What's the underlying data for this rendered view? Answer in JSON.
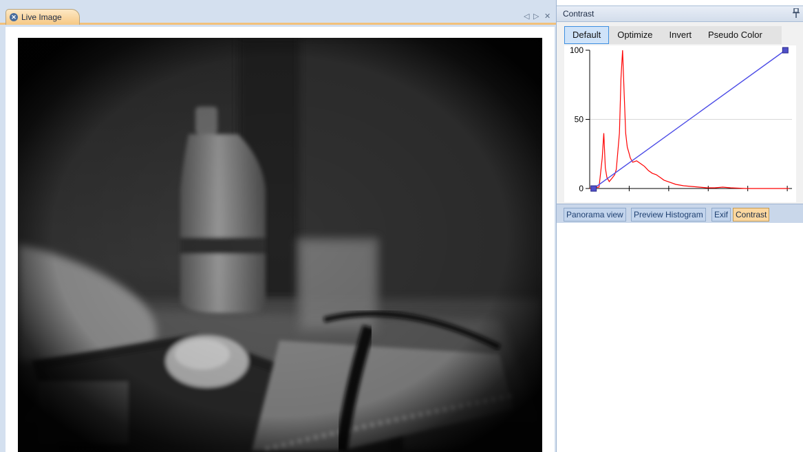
{
  "document": {
    "tab_label": "Live Image",
    "tab_close_icon": "close-circle-icon",
    "nav_prev_glyph": "◁",
    "nav_next_glyph": "▷",
    "close_glyph": "✕"
  },
  "contrast_panel": {
    "title": "Contrast",
    "pin_glyph": "📌",
    "buttons": [
      "Default",
      "Optimize",
      "Invert",
      "Pseudo Color"
    ],
    "active_button": "Default",
    "chart_data": {
      "type": "line",
      "ylim": [
        0,
        100
      ],
      "xlim": [
        0,
        255
      ],
      "y_ticks": [
        "0",
        "50",
        "100"
      ],
      "grid": "horizontal",
      "series": [
        {
          "color": "#ff0000",
          "x": [
            0,
            12,
            16,
            18,
            20,
            22,
            25,
            28,
            32,
            34,
            38,
            40,
            42,
            44,
            46,
            48,
            50,
            52,
            55,
            60,
            65,
            70,
            75,
            80,
            85,
            90,
            95,
            100,
            110,
            120,
            130,
            140,
            150,
            160,
            170,
            180,
            200,
            220,
            255
          ],
          "y": [
            0,
            1,
            22,
            40,
            15,
            8,
            5,
            7,
            10,
            14,
            40,
            80,
            100,
            70,
            40,
            30,
            26,
            22,
            19,
            20,
            18,
            16,
            13,
            11,
            10,
            8,
            6,
            5,
            3,
            2,
            1.5,
            1,
            0.5,
            0.5,
            1,
            0.5,
            0,
            0,
            0
          ]
        },
        {
          "color": "#4a4ae6",
          "x": [
            5,
            250
          ],
          "y": [
            0,
            100
          ]
        }
      ],
      "colors": {
        "histogram": "#ff0000",
        "curve": "#4a4ae6",
        "handle": "#5050c8"
      }
    }
  },
  "bottom_tabs": [
    "Panorama view",
    "Preview Histogram",
    "Exif",
    "Contrast"
  ],
  "active_bottom_tab": "Contrast",
  "colors": {
    "pane_bg": "#d4e0ef",
    "tab_active": "#f6c884",
    "button_active_border": "#3d8ee0"
  }
}
